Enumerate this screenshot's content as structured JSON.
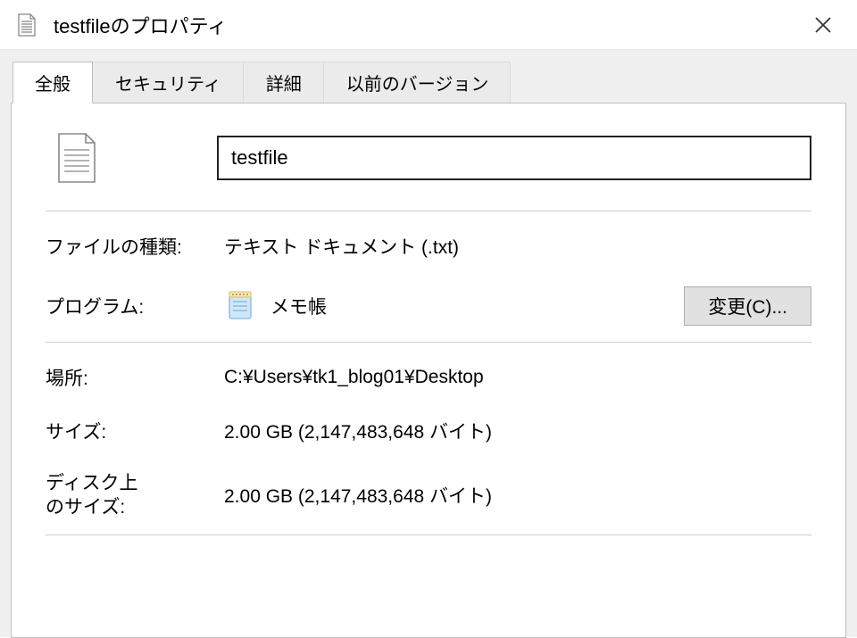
{
  "titlebar": {
    "title": "testfileのプロパティ"
  },
  "tabs": {
    "general": "全般",
    "security": "セキュリティ",
    "details": "詳細",
    "previous_versions": "以前のバージョン"
  },
  "general": {
    "filename": "testfile",
    "file_type_label": "ファイルの種類:",
    "file_type_value": "テキスト ドキュメント (.txt)",
    "program_label": "プログラム:",
    "program_value": "メモ帳",
    "change_button": "変更(C)...",
    "location_label": "場所:",
    "location_value": "C:¥Users¥tk1_blog01¥Desktop",
    "size_label": "サイズ:",
    "size_value": "2.00 GB (2,147,483,648 バイト)",
    "size_on_disk_label": "ディスク上\nのサイズ:",
    "size_on_disk_value": "2.00 GB (2,147,483,648 バイト)"
  }
}
